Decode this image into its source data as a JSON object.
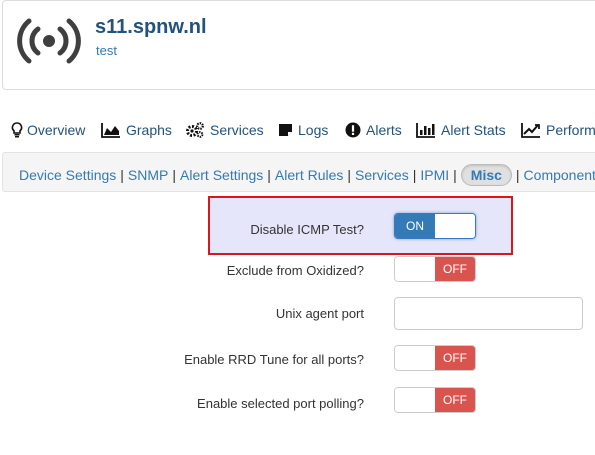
{
  "device": {
    "hostname": "s11.spnw.nl",
    "subtitle": "test",
    "icon": "wireless-broadcast-icon"
  },
  "main_nav": [
    {
      "label": "Overview",
      "icon": "lightbulb-icon"
    },
    {
      "label": "Graphs",
      "icon": "area-chart-icon"
    },
    {
      "label": "Services",
      "icon": "cogs-icon"
    },
    {
      "label": "Logs",
      "icon": "sticky-note-icon"
    },
    {
      "label": "Alerts",
      "icon": "exclamation-circle-icon"
    },
    {
      "label": "Alert Stats",
      "icon": "bar-chart-icon"
    },
    {
      "label": "Performa",
      "icon": "line-chart-icon"
    }
  ],
  "sub_nav": {
    "items": [
      "Device Settings",
      "SNMP",
      "Alert Settings",
      "Alert Rules",
      "Services",
      "IPMI",
      "Misc",
      "Components"
    ],
    "separator": "|",
    "active": "Misc"
  },
  "form": {
    "disable_icmp": {
      "label": "Disable ICMP Test?",
      "state": "ON"
    },
    "exclude_oxidized": {
      "label": "Exclude from Oxidized?",
      "state": "OFF"
    },
    "unix_agent_port": {
      "label": "Unix agent port",
      "value": ""
    },
    "rrd_tune": {
      "label": "Enable RRD Tune for all ports?",
      "state": "OFF"
    },
    "selected_port_polling": {
      "label": "Enable selected port polling?",
      "state": "OFF"
    }
  },
  "colors": {
    "link": "#337ab7",
    "on": "#337ab7",
    "off": "#d9534f",
    "highlight_border": "#d9161b",
    "highlight_fill": "#e6e6fa"
  }
}
